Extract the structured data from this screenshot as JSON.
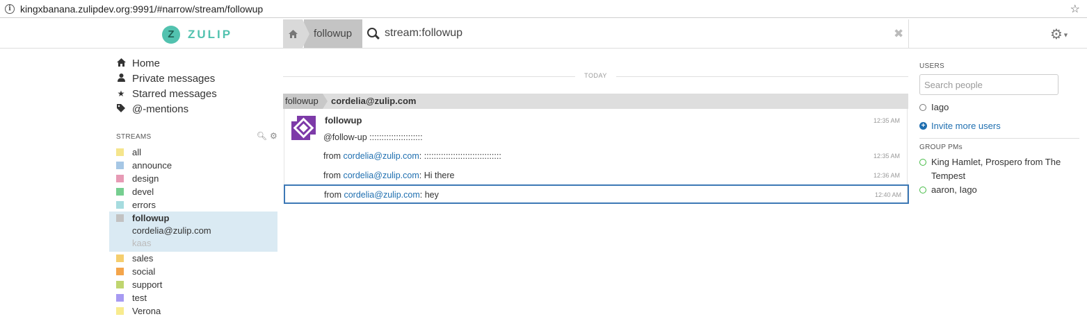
{
  "browser": {
    "url": "kingxbanana.zulipdev.org:9991/#narrow/stream/followup"
  },
  "header": {
    "logo_letter": "Z",
    "logo_text": "ZULIP",
    "narrow_stream": "followup",
    "search_query": "stream:followup",
    "clear": "✖"
  },
  "left_sidebar": {
    "nav": [
      {
        "label": "Home",
        "icon": "home-icon"
      },
      {
        "label": "Private messages",
        "icon": "user-icon"
      },
      {
        "label": "Starred messages",
        "icon": "star-icon"
      },
      {
        "label": "@-mentions",
        "icon": "tag-icon"
      }
    ],
    "streams_header": "STREAMS",
    "streams": [
      {
        "name": "all",
        "color": "#f5e58c"
      },
      {
        "name": "announce",
        "color": "#a6c7e5"
      },
      {
        "name": "design",
        "color": "#e79ab5"
      },
      {
        "name": "devel",
        "color": "#76ce90"
      },
      {
        "name": "errors",
        "color": "#a6dcdf"
      },
      {
        "name": "followup",
        "color": "#c2c2c2"
      },
      {
        "name": "sales",
        "color": "#f5ce6e"
      },
      {
        "name": "social",
        "color": "#f4a54b"
      },
      {
        "name": "support",
        "color": "#bfd56f"
      },
      {
        "name": "test",
        "color": "#a79af2"
      },
      {
        "name": "Verona",
        "color": "#f8eb8e"
      }
    ],
    "active_topics": [
      "cordelia@zulip.com",
      "kaas"
    ]
  },
  "messages": {
    "date_label": "TODAY",
    "recipient_stream": "followup",
    "recipient_topic": "cordelia@zulip.com",
    "sender": "followup",
    "first": {
      "text": "@follow-up ::::::::::::::::::::::",
      "time": "12:35 AM"
    },
    "rows": [
      {
        "prefix": "from ",
        "link": "cordelia@zulip.com",
        "suffix": ": ::::::::::::::::::::::::::::::::",
        "time": "12:35 AM"
      },
      {
        "prefix": "from ",
        "link": "cordelia@zulip.com",
        "suffix": ": Hi there",
        "time": "12:36 AM"
      },
      {
        "prefix": "from ",
        "link": "cordelia@zulip.com",
        "suffix": ": hey",
        "time": "12:40 AM"
      }
    ]
  },
  "right_sidebar": {
    "users_header": "USERS",
    "search_placeholder": "Search people",
    "users": [
      "Iago"
    ],
    "invite_label": "Invite more users",
    "group_pms_header": "GROUP PMs",
    "group_pms": [
      "King Hamlet, Prospero from The Tempest",
      "aaron, Iago"
    ]
  }
}
